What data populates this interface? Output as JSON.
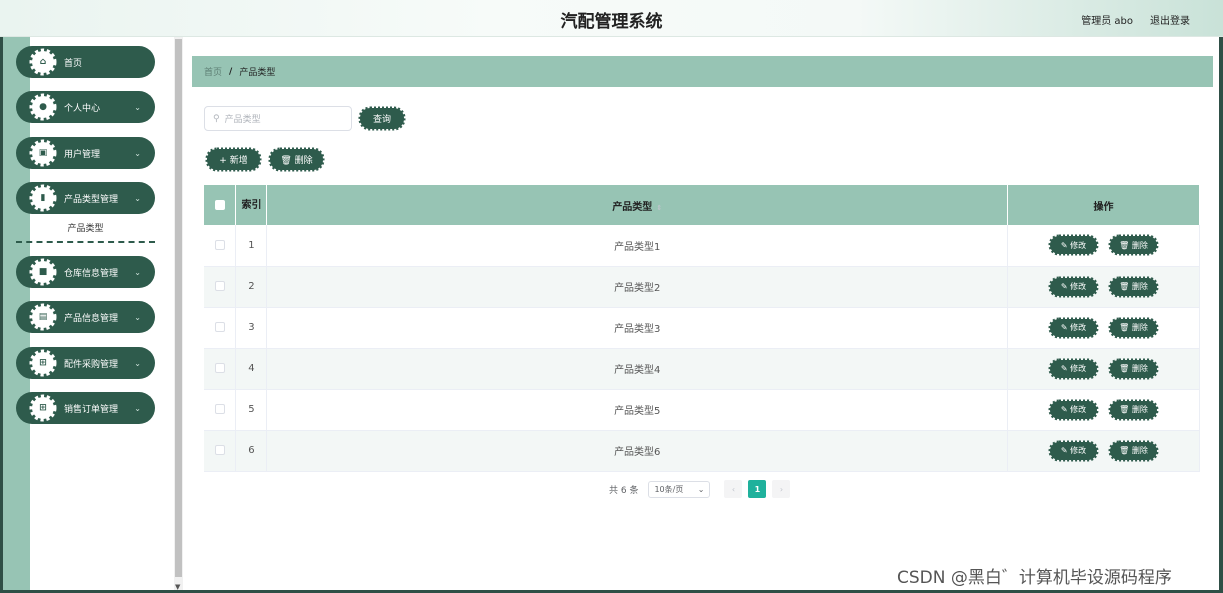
{
  "header": {
    "title": "汽配管理系统",
    "user": "管理员 abo",
    "logout": "退出登录"
  },
  "sidebar": {
    "items": [
      {
        "label": "首页",
        "icon": "home-icon",
        "glyph": "⌂",
        "chevron": ""
      },
      {
        "label": "个人中心",
        "icon": "person-icon",
        "glyph": "●",
        "chevron": "⌄"
      },
      {
        "label": "用户管理",
        "icon": "user-list-icon",
        "glyph": "▣",
        "chevron": "⌄"
      },
      {
        "label": "产品类型管理",
        "icon": "chart-icon",
        "glyph": "▮",
        "chevron": "⌄"
      },
      {
        "label": "仓库信息管理",
        "icon": "warehouse-icon",
        "glyph": "■",
        "chevron": "⌄"
      },
      {
        "label": "产品信息管理",
        "icon": "product-icon",
        "glyph": "▤",
        "chevron": "⌄"
      },
      {
        "label": "配件采购管理",
        "icon": "grid-icon",
        "glyph": "⊞",
        "chevron": "⌄"
      },
      {
        "label": "销售订单管理",
        "icon": "grid-icon",
        "glyph": "⊞",
        "chevron": "⌄"
      }
    ],
    "submenu": "产品类型"
  },
  "breadcrumb": {
    "home": "首页",
    "separator": "/",
    "current": "产品类型"
  },
  "search": {
    "placeholder": "产品类型",
    "button": "查询"
  },
  "toolbar": {
    "add": "+ 新增",
    "delete": "🗑 删除"
  },
  "table": {
    "headers": {
      "index": "索引",
      "type": "产品类型",
      "ops": "操作"
    },
    "rows": [
      {
        "index": "1",
        "type": "产品类型1"
      },
      {
        "index": "2",
        "type": "产品类型2"
      },
      {
        "index": "3",
        "type": "产品类型3"
      },
      {
        "index": "4",
        "type": "产品类型4"
      },
      {
        "index": "5",
        "type": "产品类型5"
      },
      {
        "index": "6",
        "type": "产品类型6"
      }
    ],
    "edit_label": "✎ 修改",
    "delete_label": "🗑 删除"
  },
  "pagination": {
    "total": "共 6 条",
    "page_size": "10条/页",
    "prev": "‹",
    "current": "1",
    "next": "›"
  },
  "watermark": "CSDN @黑白゛计算机毕设源码程序",
  "colors": {
    "dark_green": "#2e5b4c",
    "light_green": "#97c4b4",
    "page_active": "#1fb19c"
  }
}
